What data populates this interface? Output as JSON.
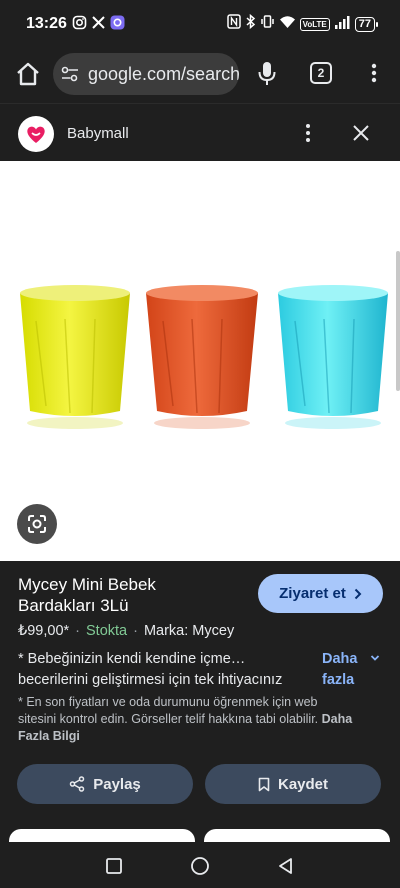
{
  "status_bar": {
    "time": "13:26",
    "battery": "77",
    "icons_left": [
      "instagram-icon",
      "x-icon",
      "app-icon"
    ],
    "icons_right": [
      "nfc-icon",
      "bluetooth-icon",
      "vibrate-icon",
      "wifi-icon",
      "volte-icon",
      "signal-icon",
      "battery-icon"
    ],
    "volte": "VoLTE"
  },
  "toolbar": {
    "url": "google.com/search",
    "tab_count": "2"
  },
  "sheet": {
    "site_name": "Babymall",
    "brand_color": "#e91e63"
  },
  "product": {
    "title": "Mycey Mini Bebek Bardakları 3Lü",
    "visit_label": "Ziyaret et",
    "price": "₺99,00*",
    "stock": "Stokta",
    "brand": "Marka: Mycey",
    "description": "* Bebeğinizin kendi kendine içme… becerilerini geliştirmesi için tek ihtiyacınız",
    "more_label": "Daha fazla",
    "note": "* En son fiyatları ve oda durumunu öğrenmek için web sitesini kontrol edin. Görseller telif hakkına tabi olabilir.",
    "note_link": "Daha Fazla Bilgi",
    "share_label": "Paylaş",
    "save_label": "Kaydet"
  },
  "colors": {
    "accent_button": "#a8c7fa",
    "stock_green": "#81c995",
    "link_blue": "#8ab4f8",
    "cup_yellow": "#dde21a",
    "cup_orange": "#e0542a",
    "cup_cyan": "#3fd6e3"
  }
}
